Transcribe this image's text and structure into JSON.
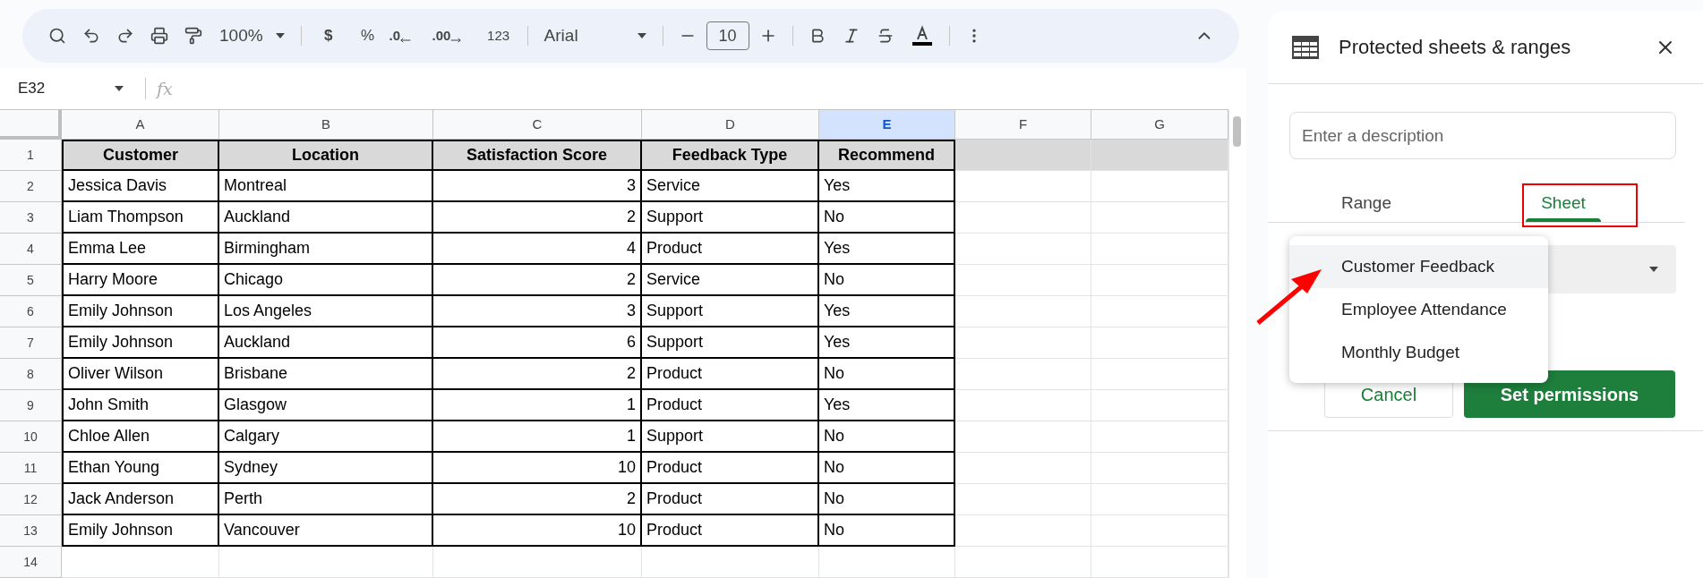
{
  "toolbar": {
    "zoom": "100%",
    "currency": "$",
    "percent": "%",
    "decrease_decimals": ".0",
    "increase_decimals": ".00",
    "number_format": "123",
    "font": "Arial",
    "font_size": "10"
  },
  "formula_bar": {
    "cell_ref": "E32",
    "fx": "fx"
  },
  "columns": [
    {
      "label": "A",
      "selected": false
    },
    {
      "label": "B",
      "selected": false
    },
    {
      "label": "C",
      "selected": false
    },
    {
      "label": "D",
      "selected": false
    },
    {
      "label": "E",
      "selected": true
    },
    {
      "label": "F",
      "selected": false
    },
    {
      "label": "G",
      "selected": false
    }
  ],
  "rows": [
    {
      "number": "1",
      "kind": "header",
      "cells": [
        "Customer",
        "Location",
        "Satisfaction Score",
        "Feedback Type",
        "Recommend"
      ]
    },
    {
      "number": "2",
      "kind": "data",
      "cells": [
        "Jessica Davis",
        "Montreal",
        "3",
        "Service",
        "Yes"
      ]
    },
    {
      "number": "3",
      "kind": "data",
      "cells": [
        "Liam Thompson",
        "Auckland",
        "2",
        "Support",
        "No"
      ]
    },
    {
      "number": "4",
      "kind": "data",
      "cells": [
        "Emma Lee",
        "Birmingham",
        "4",
        "Product",
        "Yes"
      ]
    },
    {
      "number": "5",
      "kind": "data",
      "cells": [
        "Harry Moore",
        "Chicago",
        "2",
        "Service",
        "No"
      ]
    },
    {
      "number": "6",
      "kind": "data",
      "cells": [
        "Emily Johnson",
        "Los Angeles",
        "3",
        "Support",
        "Yes"
      ]
    },
    {
      "number": "7",
      "kind": "data",
      "cells": [
        "Emily Johnson",
        "Auckland",
        "6",
        "Support",
        "Yes"
      ]
    },
    {
      "number": "8",
      "kind": "data",
      "cells": [
        "Oliver Wilson",
        "Brisbane",
        "2",
        "Product",
        "No"
      ]
    },
    {
      "number": "9",
      "kind": "data",
      "cells": [
        "John Smith",
        "Glasgow",
        "1",
        "Product",
        "Yes"
      ]
    },
    {
      "number": "10",
      "kind": "data",
      "cells": [
        "Chloe Allen",
        "Calgary",
        "1",
        "Support",
        "No"
      ]
    },
    {
      "number": "11",
      "kind": "data",
      "cells": [
        "Ethan Young",
        "Sydney",
        "10",
        "Product",
        "No"
      ]
    },
    {
      "number": "12",
      "kind": "data",
      "cells": [
        "Jack Anderson",
        "Perth",
        "2",
        "Product",
        "No"
      ]
    },
    {
      "number": "13",
      "kind": "data",
      "cells": [
        "Emily Johnson",
        "Vancouver",
        "10",
        "Product",
        "No"
      ]
    },
    {
      "number": "14",
      "kind": "empty",
      "cells": []
    }
  ],
  "panel": {
    "title": "Protected sheets & ranges",
    "description_placeholder": "Enter a description",
    "tabs": [
      {
        "label": "Range",
        "selected": false
      },
      {
        "label": "Sheet",
        "selected": true
      }
    ],
    "sheet_menu": [
      {
        "label": "Customer Feedback",
        "selected": true
      },
      {
        "label": "Employee Attendance",
        "selected": false
      },
      {
        "label": "Monthly Budget",
        "selected": false
      }
    ],
    "cancel": "Cancel",
    "confirm": "Set permissions"
  }
}
